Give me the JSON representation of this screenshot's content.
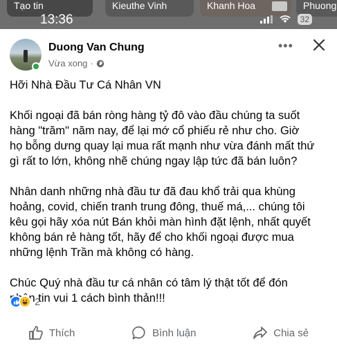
{
  "status_bar": {
    "time": "13:36",
    "battery": "32",
    "stories": [
      "Tạo tin",
      "Kieuthe Vinh",
      "Khanh Hoa",
      "Phuong"
    ]
  },
  "post": {
    "author": "Duong Van Chung",
    "timestamp": "Vừa xong",
    "audience_icon": "globe-icon",
    "paragraphs": [
      "Hỡi Nhà Đầu Tư Cá Nhân VN",
      "Khối ngoại đã bán ròng hàng tỷ đô vào đầu chúng ta suốt\nhàng \"trăm\" năm nay, để lại mớ cổ phiếu rẻ như cho. Giờ\nhọ bỗng dưng quay lại mua rất mạnh như vừa đánh mất thứ\ngì rất to lớn,  không nhẽ chúng ngay lập tức đã bán luôn?",
      "Nhân danh những nhà đầu tư đã đau khổ trải qua khùng\nhoảng, covid, chiến tranh trung đông, thuế má,... chúng tôi\nkêu gọi hãy xóa nút Bán khỏi màn hình đặt lệnh, nhất quyết\nkhông bán rẻ hàng tốt, hãy để cho khối ngoại được mua\nnhững lệnh Trần mà không có hàng.",
      "Chúc Quý nhà đầu tư cá nhân có tâm lý thật tốt để đón\nnhận tin vui 1 cách bình thản!!!"
    ],
    "reactions": {
      "types": [
        "like",
        "haha"
      ],
      "count": "2"
    },
    "actions": {
      "like": "Thích",
      "comment": "Bình luận",
      "share": "Chia sẻ"
    }
  },
  "colors": {
    "accent": "#1877f2",
    "muted": "#65676b",
    "online": "#31a24c"
  }
}
